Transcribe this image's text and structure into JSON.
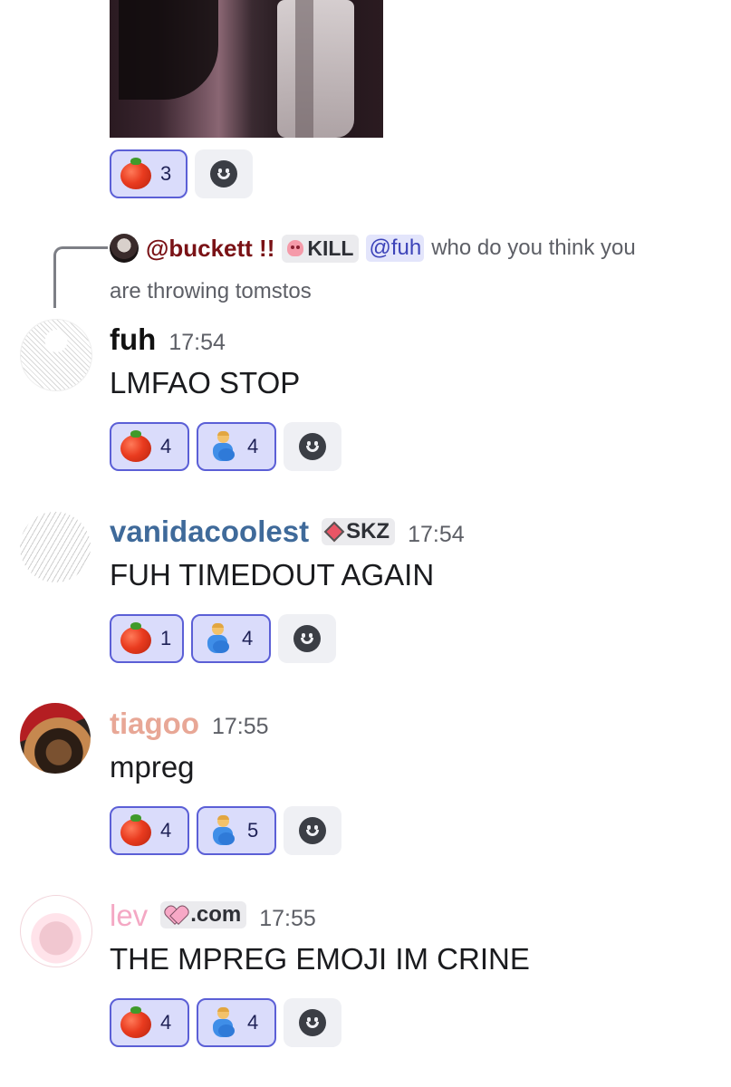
{
  "reply": {
    "author": "@buckett !!",
    "author_tag": "KILL",
    "mention": "@fuh",
    "text_line1": "who do you think you",
    "text_line2": "are throwing tomstos"
  },
  "top_reactions": [
    {
      "emoji": "tomato",
      "count": "3"
    }
  ],
  "messages": [
    {
      "username": "fuh",
      "username_color": "#111111",
      "time": "17:54",
      "text": "LMFAO STOP",
      "reactions": [
        {
          "emoji": "tomato",
          "count": "4"
        },
        {
          "emoji": "pregnant-man",
          "count": "4"
        }
      ]
    },
    {
      "username": "vanidacoolest",
      "username_color": "#3f6a9a",
      "tag": "SKZ",
      "time": "17:54",
      "text": "FUH TIMEDOUT AGAIN",
      "reactions": [
        {
          "emoji": "tomato",
          "count": "1"
        },
        {
          "emoji": "pregnant-man",
          "count": "4"
        }
      ]
    },
    {
      "username": "tiagoo",
      "username_color": "#e8a796",
      "time": "17:55",
      "text": "mpreg",
      "reactions": [
        {
          "emoji": "tomato",
          "count": "4"
        },
        {
          "emoji": "pregnant-man",
          "count": "5"
        }
      ]
    },
    {
      "username": "lev",
      "username_color": "#f4a8c4",
      "tag": ".com",
      "time": "17:55",
      "text": "THE MPREG EMOJI IM CRINE",
      "reactions": [
        {
          "emoji": "tomato",
          "count": "4"
        },
        {
          "emoji": "pregnant-man",
          "count": "4"
        }
      ]
    }
  ],
  "colors": {
    "reaction_active_bg": "#dadcfb",
    "reaction_active_border": "#5b5fd6",
    "reply_author": "#7a1216",
    "mention": "#3c43b9"
  }
}
